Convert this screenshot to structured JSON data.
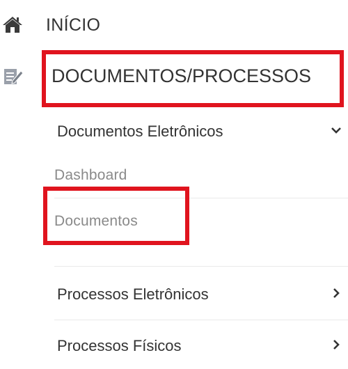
{
  "nav": {
    "inicio": {
      "label": "INÍCIO",
      "icon": "home-icon"
    },
    "docs_processos": {
      "label": "DOCUMENTOS/PROCESSOS",
      "icon": "edit-document-icon"
    }
  },
  "submenu": {
    "documentos_eletronicos": {
      "label": "Documentos Eletrônicos",
      "icon": "chevron-down-icon",
      "items": [
        {
          "label": "Dashboard"
        },
        {
          "label": "Documentos"
        }
      ]
    },
    "processos_eletronicos": {
      "label": "Processos Eletrônicos",
      "icon": "chevron-right-icon"
    },
    "processos_fisicos": {
      "label": "Processos Físicos",
      "icon": "chevron-right-icon"
    }
  },
  "colors": {
    "highlight": "#e0141e",
    "text_primary": "#333333",
    "text_muted": "#8a8a8a",
    "divider": "#e9e9e9"
  }
}
